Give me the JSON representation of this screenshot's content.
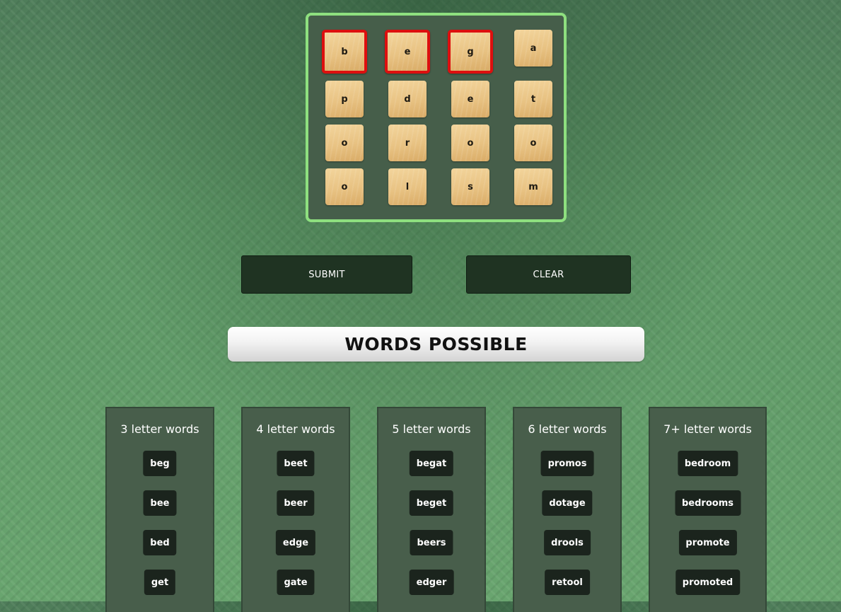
{
  "board": {
    "rows": [
      [
        "b",
        "e",
        "g",
        "a"
      ],
      [
        "p",
        "d",
        "e",
        "t"
      ],
      [
        "o",
        "r",
        "o",
        "o"
      ],
      [
        "o",
        "l",
        "s",
        "m"
      ]
    ],
    "selected": [
      [
        0,
        0
      ],
      [
        0,
        1
      ],
      [
        0,
        2
      ]
    ],
    "colors": {
      "border": "#8ee07f",
      "background": "#465e4a",
      "selected_border": "#dd0f0f"
    }
  },
  "actions": {
    "submit_label": "SUBMIT",
    "clear_label": "CLEAR"
  },
  "words_heading": "WORDS POSSIBLE",
  "word_columns": [
    {
      "title": "3 letter words",
      "words": [
        "beg",
        "bee",
        "bed",
        "get"
      ]
    },
    {
      "title": "4 letter words",
      "words": [
        "beet",
        "beer",
        "edge",
        "gate"
      ]
    },
    {
      "title": "5 letter words",
      "words": [
        "begat",
        "beget",
        "beers",
        "edger"
      ]
    },
    {
      "title": "6 letter words",
      "words": [
        "promos",
        "dotage",
        "drools",
        "retool"
      ]
    },
    {
      "title": "7+ letter words",
      "words": [
        "bedroom",
        "bedrooms",
        "promote",
        "promoted"
      ]
    }
  ]
}
